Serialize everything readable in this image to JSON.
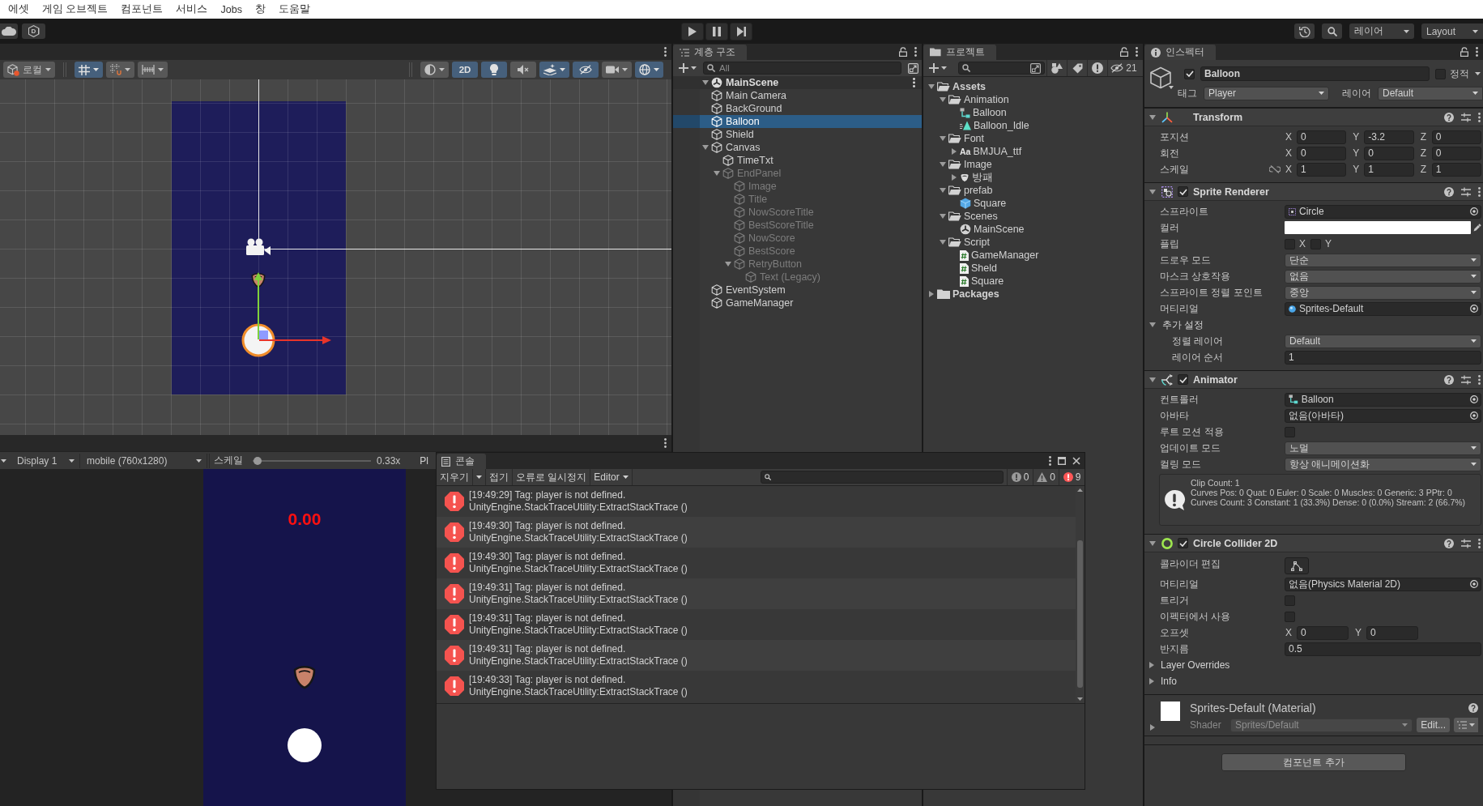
{
  "menu_bar": {
    "items": [
      "에셋",
      "게임 오브젝트",
      "컴포넌트",
      "서비스",
      "Jobs",
      "창",
      "도움말"
    ]
  },
  "main_toolbar": {
    "account": "D",
    "layers": "레이어",
    "layout": "Layout"
  },
  "scene_view": {
    "toolbar": {
      "pivot": "로컬",
      "snap_buttons": [
        {
          "kind": "grid",
          "selected": true
        },
        {
          "kind": "increment",
          "selected": false
        },
        {
          "kind": "ruler",
          "selected": false
        }
      ],
      "view_buttons": [
        {
          "kind": "shading",
          "selected": false
        },
        {
          "kind": "mode_2d",
          "label": "2D",
          "selected": true
        },
        {
          "kind": "lighting",
          "selected": true
        },
        {
          "kind": "audio",
          "selected": false
        },
        {
          "kind": "effects",
          "selected": true
        },
        {
          "kind": "visibility",
          "selected": true
        },
        {
          "kind": "camera",
          "selected": false
        },
        {
          "kind": "gizmos",
          "selected": true
        }
      ]
    }
  },
  "game_view": {
    "toolbar": {
      "display": "Display 1",
      "resolution": "mobile (760x1280)",
      "scale_label": "스케일",
      "scale": {
        "level": 0.03
      },
      "scale_reading": "0.33x",
      "cut_label": "Pl"
    },
    "screen": {
      "timer": "0.00"
    }
  },
  "hierarchy": {
    "title": "계층 구조",
    "search": {
      "placeholder": "All"
    },
    "scene": {
      "name": "MainScene",
      "expanded": true,
      "children": [
        {
          "name": "Main Camera",
          "selected": false,
          "active": true
        },
        {
          "name": "BackGround",
          "selected": false,
          "active": true
        },
        {
          "name": "Balloon",
          "selected": true,
          "active": true
        },
        {
          "name": "Shield",
          "selected": false,
          "active": true
        },
        {
          "name": "Canvas",
          "selected": false,
          "active": true,
          "expanded": true,
          "children": [
            {
              "name": "TimeTxt",
              "selected": false,
              "active": true
            },
            {
              "name": "EndPanel",
              "selected": false,
              "active": false,
              "expanded": true,
              "children": [
                {
                  "name": "Image",
                  "selected": false,
                  "active": false
                },
                {
                  "name": "Title",
                  "selected": false,
                  "active": false
                },
                {
                  "name": "NowScoreTitle",
                  "selected": false,
                  "active": false
                },
                {
                  "name": "BestScoreTitle",
                  "selected": false,
                  "active": false
                },
                {
                  "name": "NowScore",
                  "selected": false,
                  "active": false
                },
                {
                  "name": "BestScore",
                  "selected": false,
                  "active": false
                },
                {
                  "name": "RetryButton",
                  "selected": false,
                  "active": false,
                  "expanded": true,
                  "children": [
                    {
                      "name": "Text (Legacy)",
                      "selected": false,
                      "active": false
                    }
                  ]
                }
              ]
            }
          ]
        },
        {
          "name": "EventSystem",
          "selected": false,
          "active": true
        },
        {
          "name": "GameManager",
          "selected": false,
          "active": true
        }
      ]
    }
  },
  "project": {
    "title": "프로젝트",
    "hidden_count": "21",
    "tree": [
      {
        "name": "Assets",
        "kind": "folder",
        "selected": false,
        "expanded": true,
        "children": [
          {
            "name": "Animation",
            "kind": "folder",
            "selected": false,
            "expanded": true,
            "children": [
              {
                "name": "Balloon",
                "kind": "controller",
                "selected": false
              },
              {
                "name": "Balloon_Idle",
                "kind": "clip",
                "selected": false
              }
            ]
          },
          {
            "name": "Font",
            "kind": "folder",
            "selected": false,
            "expanded": true,
            "children": [
              {
                "name": "BMJUA_ttf",
                "kind": "font",
                "badge": "Aa",
                "selected": false,
                "expanded": false
              }
            ]
          },
          {
            "name": "Image",
            "kind": "folder",
            "selected": false,
            "expanded": true,
            "children": [
              {
                "name": "방패",
                "kind": "sprite",
                "selected": false,
                "expanded": false
              }
            ]
          },
          {
            "name": "prefab",
            "kind": "folder",
            "selected": false,
            "expanded": true,
            "children": [
              {
                "name": "Square",
                "kind": "prefab",
                "selected": false
              }
            ]
          },
          {
            "name": "Scenes",
            "kind": "folder",
            "selected": false,
            "expanded": true,
            "children": [
              {
                "name": "MainScene",
                "kind": "scene",
                "selected": false
              }
            ]
          },
          {
            "name": "Script",
            "kind": "folder",
            "selected": false,
            "expanded": true,
            "children": [
              {
                "name": "GameManager",
                "kind": "script",
                "selected": false
              },
              {
                "name": "Sheld",
                "kind": "script",
                "selected": false
              },
              {
                "name": "Square",
                "kind": "script",
                "selected": false
              }
            ]
          }
        ]
      },
      {
        "name": "Packages",
        "kind": "folder",
        "selected": false,
        "expanded": false
      }
    ]
  },
  "inspector": {
    "title": "인스펙터",
    "object": {
      "active": true,
      "name": "Balloon",
      "static": false,
      "static_label": "정적",
      "tag_label": "태그",
      "tag": "Player",
      "layer_label": "레이어",
      "layer": "Default"
    },
    "components": [
      {
        "kind": "transform",
        "name": "Transform",
        "expanded": true,
        "rows": [
          {
            "kind": "vector",
            "label": "포지션",
            "fields": [
              {
                "axis": "X",
                "value": "0"
              },
              {
                "axis": "Y",
                "value": "-3.2"
              },
              {
                "axis": "Z",
                "value": "0"
              }
            ]
          },
          {
            "kind": "vector",
            "label": "회전",
            "fields": [
              {
                "axis": "X",
                "value": "0"
              },
              {
                "axis": "Y",
                "value": "0"
              },
              {
                "axis": "Z",
                "value": "0"
              }
            ]
          },
          {
            "kind": "vector",
            "label": "스케일",
            "proportional": false,
            "fields": [
              {
                "axis": "X",
                "value": "1"
              },
              {
                "axis": "Y",
                "value": "1"
              },
              {
                "axis": "Z",
                "value": "1"
              }
            ]
          }
        ]
      },
      {
        "kind": "sprite_renderer",
        "name": "Sprite Renderer",
        "enabled": true,
        "expanded": true,
        "rows": [
          {
            "kind": "object",
            "label": "스프라이트",
            "value": "Circle",
            "asset": {
              "kind": "sprite"
            }
          },
          {
            "kind": "color",
            "label": "컬러",
            "color": "#ffffff"
          },
          {
            "kind": "flags",
            "label": "플립",
            "flags": [
              {
                "label": "X",
                "checked": false
              },
              {
                "label": "Y",
                "checked": false
              }
            ]
          },
          {
            "kind": "dropdown",
            "label": "드로우 모드",
            "value": "단순"
          },
          {
            "kind": "dropdown",
            "label": "마스크 상호작용",
            "value": "없음"
          },
          {
            "kind": "dropdown",
            "label": "스프라이트 정렬 포인트",
            "value": "중앙"
          },
          {
            "kind": "object",
            "label": "머티리얼",
            "value": "Sprites-Default",
            "asset": {
              "kind": "material"
            }
          },
          {
            "kind": "foldout",
            "label": "추가 설정",
            "expanded": true,
            "children": [
              {
                "kind": "dropdown",
                "label": "정렬 레이어",
                "value": "Default"
              },
              {
                "kind": "number",
                "label": "레이어 순서",
                "value": "1"
              }
            ]
          }
        ]
      },
      {
        "kind": "animator",
        "name": "Animator",
        "enabled": true,
        "expanded": true,
        "rows": [
          {
            "kind": "object",
            "label": "컨트롤러",
            "value": "Balloon",
            "asset": {
              "kind": "controller"
            }
          },
          {
            "kind": "object",
            "label": "아바타",
            "value": "없음(아바타)"
          },
          {
            "kind": "checkbox",
            "label": "루트 모션 적용",
            "checked": false
          },
          {
            "kind": "dropdown",
            "label": "업데이트 모드",
            "value": "노멀"
          },
          {
            "kind": "dropdown",
            "label": "컬링 모드",
            "value": "항상 애니메이션화"
          },
          {
            "kind": "info",
            "lines": [
              "Clip Count: 1",
              "Curves Pos: 0 Quat: 0 Euler: 0 Scale: 0 Muscles: 0 Generic: 3 PPtr: 0",
              "Curves Count: 3 Constant: 1 (33.3%) Dense: 0 (0.0%) Stream: 2 (66.7%)"
            ]
          }
        ]
      },
      {
        "kind": "circle_collider",
        "name": "Circle Collider 2D",
        "enabled": true,
        "expanded": true,
        "rows": [
          {
            "kind": "edit_button",
            "label": "콜라이더 편집"
          },
          {
            "kind": "object",
            "label": "머티리얼",
            "value": "없음(Physics Material 2D)"
          },
          {
            "kind": "checkbox",
            "label": "트리거",
            "checked": false
          },
          {
            "kind": "checkbox",
            "label": "이펙터에서 사용",
            "checked": false
          },
          {
            "kind": "vector",
            "label": "오프셋",
            "fields": [
              {
                "axis": "X",
                "value": "0"
              },
              {
                "axis": "Y",
                "value": "0"
              }
            ]
          },
          {
            "kind": "number",
            "label": "반지름",
            "value": "0.5"
          },
          {
            "kind": "foldout",
            "label": "Layer Overrides",
            "expanded": false
          },
          {
            "kind": "foldout",
            "label": "Info",
            "expanded": false
          }
        ]
      }
    ],
    "material": {
      "name": "Sprites-Default (Material)",
      "expanded": false,
      "shader_label": "Shader",
      "shader": "Sprites/Default",
      "edit": "Edit..."
    },
    "add_component": "컴포넌트 추가"
  },
  "console": {
    "title": "콘솔",
    "toolbar": {
      "clear": "지우기",
      "collapse": "접기",
      "error_pause": "오류로 일시정지",
      "editor": "Editor"
    },
    "counts": [
      {
        "kind": "info",
        "count": "0"
      },
      {
        "kind": "warning",
        "count": "0"
      },
      {
        "kind": "error",
        "count": "9"
      }
    ],
    "entries": [
      {
        "kind": "error",
        "selected": false,
        "message": "[19:49:29] Tag: player is not defined.",
        "trace": "UnityEngine.StackTraceUtility:ExtractStackTrace ()"
      },
      {
        "kind": "error",
        "selected": false,
        "message": "[19:49:30] Tag: player is not defined.",
        "trace": "UnityEngine.StackTraceUtility:ExtractStackTrace ()"
      },
      {
        "kind": "error",
        "selected": false,
        "message": "[19:49:30] Tag: player is not defined.",
        "trace": "UnityEngine.StackTraceUtility:ExtractStackTrace ()"
      },
      {
        "kind": "error",
        "selected": false,
        "message": "[19:49:31] Tag: player is not defined.",
        "trace": "UnityEngine.StackTraceUtility:ExtractStackTrace ()"
      },
      {
        "kind": "error",
        "selected": false,
        "message": "[19:49:31] Tag: player is not defined.",
        "trace": "UnityEngine.StackTraceUtility:ExtractStackTrace ()"
      },
      {
        "kind": "error",
        "selected": false,
        "message": "[19:49:31] Tag: player is not defined.",
        "trace": "UnityEngine.StackTraceUtility:ExtractStackTrace ()"
      },
      {
        "kind": "error",
        "selected": false,
        "message": "[19:49:33] Tag: player is not defined.",
        "trace": "UnityEngine.StackTraceUtility:ExtractStackTrace ()"
      }
    ]
  }
}
